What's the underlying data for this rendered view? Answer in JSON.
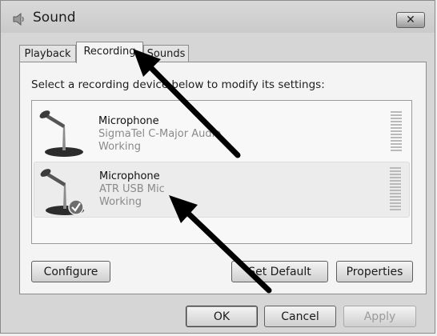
{
  "window": {
    "title": "Sound",
    "close_symbol": "✕"
  },
  "tabs": [
    {
      "label": "Playback",
      "active": false
    },
    {
      "label": "Recording",
      "active": true
    },
    {
      "label": "Sounds",
      "active": false
    }
  ],
  "instructions": "Select a recording device below to modify its settings:",
  "devices": [
    {
      "name": "Microphone",
      "description": "SigmaTel C-Major Audio",
      "status": "Working",
      "is_default": false,
      "icon": "microphone-icon"
    },
    {
      "name": "Microphone",
      "description": "ATR USB Mic",
      "status": "Working",
      "is_default": true,
      "icon": "microphone-default-icon"
    }
  ],
  "buttons": {
    "configure": "Configure",
    "set_default": "Set Default",
    "properties": "Properties",
    "ok": "OK",
    "cancel": "Cancel",
    "apply": "Apply"
  },
  "colors": {
    "panel": "#f4f4f4",
    "window": "#d6d6d6",
    "arrow": "#000000"
  }
}
